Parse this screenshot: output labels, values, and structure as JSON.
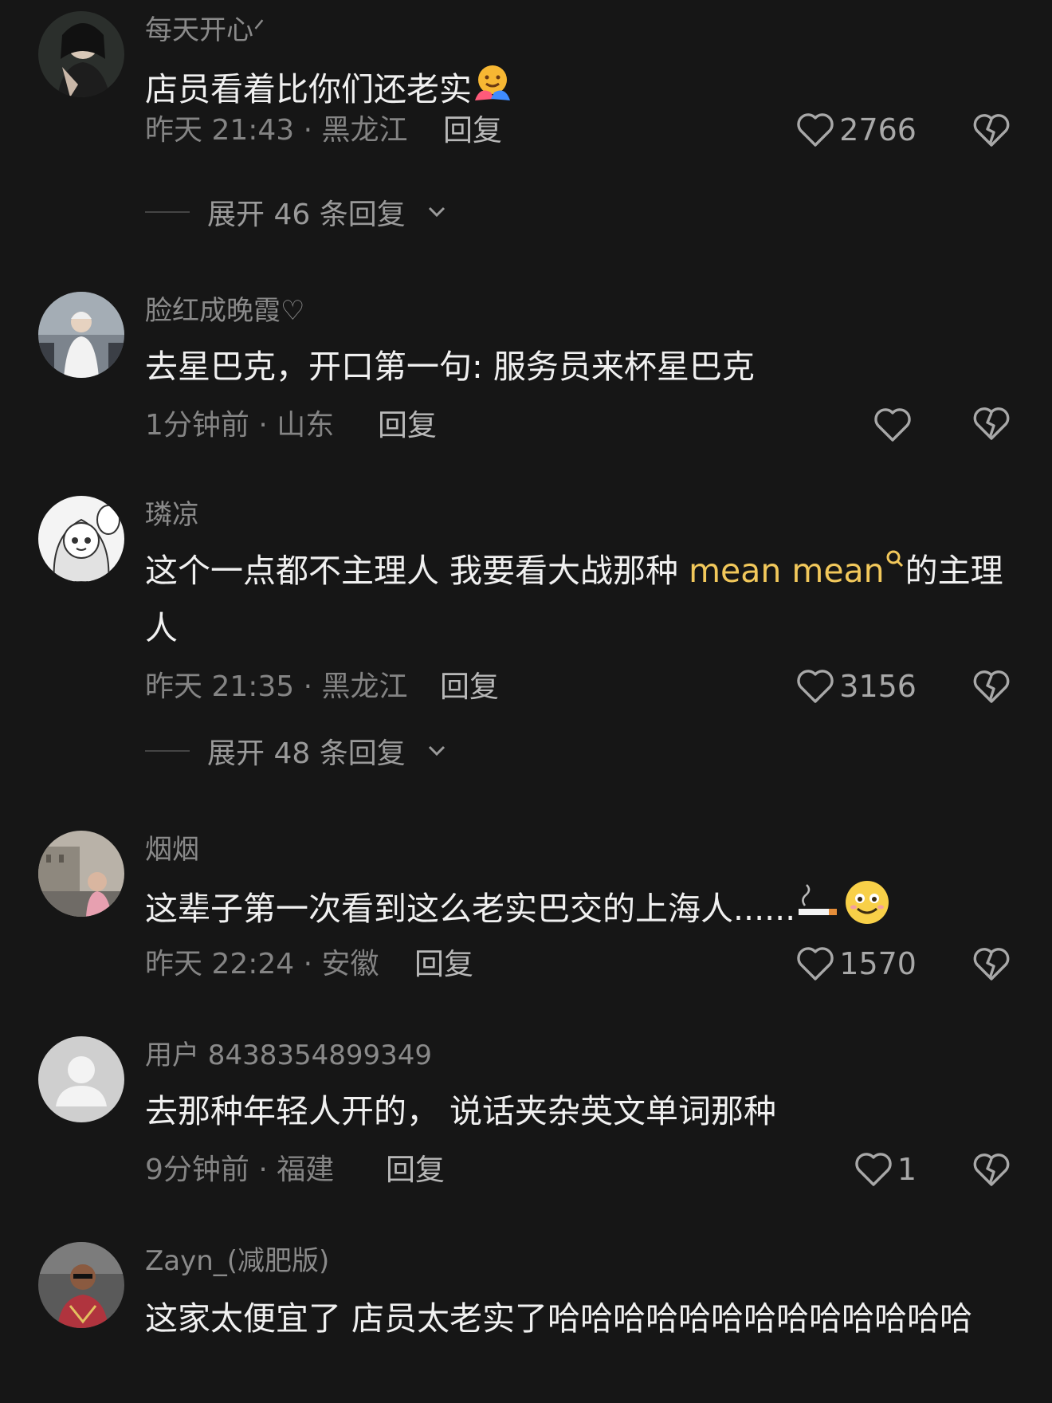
{
  "comments": [
    {
      "username": "每天开心ᐟ",
      "text": "店员看着比你们还老实",
      "time_location": "昨天 21:43 · 黑龙江",
      "reply_label": "回复",
      "likes": "2766",
      "expand": "展开 46 条回复"
    },
    {
      "username": "脸红成晚霞♡",
      "text": "去星巴克，开口第一句: 服务员来杯星巴克",
      "time_location": "1分钟前 · 山东",
      "reply_label": "回复",
      "likes": ""
    },
    {
      "username": "璘凉",
      "text_before": "这个一点都不主理人 我要看大战那种 ",
      "link_text": "mean mean",
      "text_after": "的主理人",
      "time_location": "昨天 21:35 · 黑龙江",
      "reply_label": "回复",
      "likes": "3156",
      "expand": "展开 48 条回复"
    },
    {
      "username": "烟烟",
      "text": "这辈子第一次看到这么老实巴交的上海人......",
      "time_location": "昨天 22:24 · 安徽",
      "reply_label": "回复",
      "likes": "1570"
    },
    {
      "username": "用户 8438354899349",
      "text": "去那种年轻人开的， 说话夹杂英文单词那种",
      "time_location": "9分钟前 · 福建",
      "reply_label": "回复",
      "likes": "1"
    },
    {
      "username": "Zayn_(减肥版)",
      "text": "这家太便宜了 店员太老实了哈哈哈哈哈哈哈哈哈哈哈哈哈"
    }
  ],
  "colors": {
    "background": "#161616",
    "link": "#f2c85b",
    "muted": "#848484"
  },
  "icons": [
    "heart-icon",
    "broken-heart-icon",
    "chevron-down-icon",
    "search-icon",
    "hug-emoji",
    "cigarette-emoji",
    "smile-emoji"
  ]
}
